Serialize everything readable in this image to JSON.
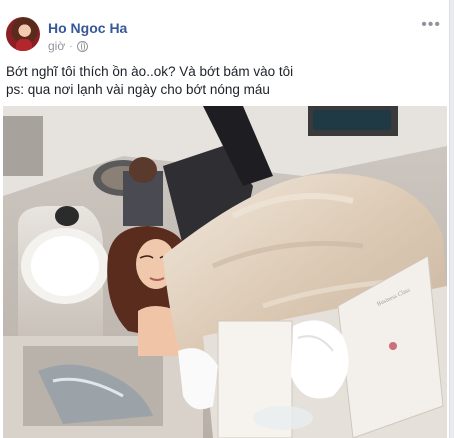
{
  "post": {
    "author": "Ho Ngoc Ha",
    "time": "giờ",
    "privacy_icon": "globe-icon",
    "more_icon": "ellipsis-icon",
    "text_lines": [
      "Bớt nghĩ tôi thích ồn ào..ok? Và bớt bám vào tôi",
      "ps: qua nơi lạnh vài ngày cho bớt nóng máu"
    ],
    "photo": {
      "box_text": "Business Class"
    }
  }
}
